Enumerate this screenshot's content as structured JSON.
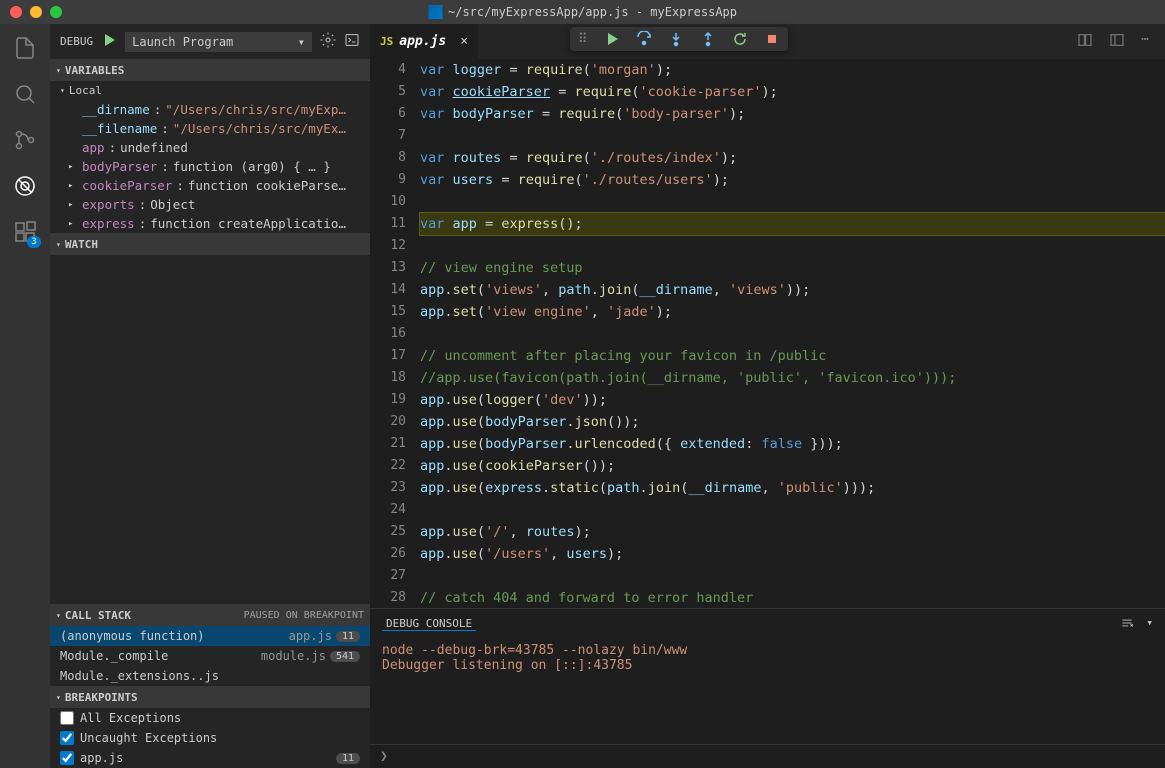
{
  "window": {
    "title": "~/src/myExpressApp/app.js - myExpressApp"
  },
  "activity": {
    "badge": "3"
  },
  "debug": {
    "label": "DEBUG",
    "config": "Launch Program",
    "configChevron": "▾"
  },
  "variables": {
    "header": "VARIABLES",
    "scope": "Local",
    "items": [
      {
        "arrow": "",
        "name": "__dirname",
        "nameClass": "vname-special",
        "sep": ":",
        "val": "\"/Users/chris/src/myExp…",
        "valClass": "vstr"
      },
      {
        "arrow": "",
        "name": "__filename",
        "nameClass": "vname-special",
        "sep": ":",
        "val": "\"/Users/chris/src/myEx…",
        "valClass": "vstr"
      },
      {
        "arrow": "",
        "name": "app",
        "nameClass": "vname",
        "sep": ":",
        "val": "undefined",
        "valClass": "vval"
      },
      {
        "arrow": "▸",
        "name": "bodyParser",
        "nameClass": "vname",
        "sep": ":",
        "val": "function (arg0) { … }",
        "valClass": "vval"
      },
      {
        "arrow": "▸",
        "name": "cookieParser",
        "nameClass": "vname",
        "sep": ":",
        "val": "function cookieParse…",
        "valClass": "vval"
      },
      {
        "arrow": "▸",
        "name": "exports",
        "nameClass": "vname",
        "sep": ":",
        "val": "Object",
        "valClass": "vval"
      },
      {
        "arrow": "▸",
        "name": "express",
        "nameClass": "vname",
        "sep": ":",
        "val": "function createApplicatio…",
        "valClass": "vval"
      }
    ]
  },
  "watch": {
    "header": "WATCH"
  },
  "callstack": {
    "header": "CALL STACK",
    "status": "PAUSED ON BREAKPOINT",
    "frames": [
      {
        "name": "(anonymous function)",
        "file": "app.js",
        "line": "11",
        "active": true
      },
      {
        "name": "Module._compile",
        "file": "module.js",
        "line": "541",
        "active": false
      },
      {
        "name": "Module._extensions..js",
        "file": "",
        "line": "",
        "active": false
      }
    ]
  },
  "breakpoints": {
    "header": "BREAKPOINTS",
    "items": [
      {
        "checked": false,
        "label": "All Exceptions",
        "badge": ""
      },
      {
        "checked": true,
        "label": "Uncaught Exceptions",
        "badge": ""
      },
      {
        "checked": true,
        "label": "app.js",
        "badge": "11"
      }
    ]
  },
  "tab": {
    "icon": "JS",
    "name": "app.js",
    "close": "×"
  },
  "editor": {
    "lines": [
      {
        "n": 4,
        "html": "<span class='kw'>var</span> <span class='id'>logger</span> <span class='pn'>=</span> <span class='fn'>require</span><span class='pn'>(</span><span class='str'>'morgan'</span><span class='pn'>);</span>"
      },
      {
        "n": 5,
        "html": "<span class='kw'>var</span> <span class='id linku'>cookieParser</span> <span class='pn'>=</span> <span class='fn'>require</span><span class='pn'>(</span><span class='str'>'cookie-parser'</span><span class='pn'>);</span>"
      },
      {
        "n": 6,
        "html": "<span class='kw'>var</span> <span class='id'>bodyParser</span> <span class='pn'>=</span> <span class='fn'>require</span><span class='pn'>(</span><span class='str'>'body-parser'</span><span class='pn'>);</span>"
      },
      {
        "n": 7,
        "html": ""
      },
      {
        "n": 8,
        "html": "<span class='kw'>var</span> <span class='id'>routes</span> <span class='pn'>=</span> <span class='fn'>require</span><span class='pn'>(</span><span class='str'>'./routes/index'</span><span class='pn'>);</span>"
      },
      {
        "n": 9,
        "html": "<span class='kw'>var</span> <span class='id'>users</span> <span class='pn'>=</span> <span class='fn'>require</span><span class='pn'>(</span><span class='str'>'./routes/users'</span><span class='pn'>);</span>"
      },
      {
        "n": 10,
        "html": ""
      },
      {
        "n": 11,
        "hl": true,
        "bp": true,
        "html": "<span class='kw'>var</span> <span class='id'>app</span> <span class='pn'>=</span> <span class='fn'>express</span><span class='pn'>();</span>"
      },
      {
        "n": 12,
        "html": ""
      },
      {
        "n": 13,
        "html": "<span class='cm'>// view engine setup</span>"
      },
      {
        "n": 14,
        "html": "<span class='id'>app</span><span class='pn'>.</span><span class='fn'>set</span><span class='pn'>(</span><span class='str'>'views'</span><span class='pn'>, </span><span class='id'>path</span><span class='pn'>.</span><span class='fn'>join</span><span class='pn'>(</span><span class='id'>__dirname</span><span class='pn'>, </span><span class='str'>'views'</span><span class='pn'>));</span>"
      },
      {
        "n": 15,
        "html": "<span class='id'>app</span><span class='pn'>.</span><span class='fn'>set</span><span class='pn'>(</span><span class='str'>'view engine'</span><span class='pn'>, </span><span class='str'>'jade'</span><span class='pn'>);</span>"
      },
      {
        "n": 16,
        "html": ""
      },
      {
        "n": 17,
        "html": "<span class='cm'>// uncomment after placing your favicon in /public</span>"
      },
      {
        "n": 18,
        "html": "<span class='cm'>//app.use(favicon(path.join(__dirname, 'public', 'favicon.ico')));</span>"
      },
      {
        "n": 19,
        "html": "<span class='id'>app</span><span class='pn'>.</span><span class='fn'>use</span><span class='pn'>(</span><span class='fn'>logger</span><span class='pn'>(</span><span class='str'>'dev'</span><span class='pn'>));</span>"
      },
      {
        "n": 20,
        "html": "<span class='id'>app</span><span class='pn'>.</span><span class='fn'>use</span><span class='pn'>(</span><span class='id'>bodyParser</span><span class='pn'>.</span><span class='fn'>json</span><span class='pn'>());</span>"
      },
      {
        "n": 21,
        "html": "<span class='id'>app</span><span class='pn'>.</span><span class='fn'>use</span><span class='pn'>(</span><span class='id'>bodyParser</span><span class='pn'>.</span><span class='fn'>urlencoded</span><span class='pn'>({ </span><span class='id'>extended</span><span class='pn'>: </span><span class='kw'>false</span><span class='pn'> }));</span>"
      },
      {
        "n": 22,
        "html": "<span class='id'>app</span><span class='pn'>.</span><span class='fn'>use</span><span class='pn'>(</span><span class='fn'>cookieParser</span><span class='pn'>());</span>"
      },
      {
        "n": 23,
        "html": "<span class='id'>app</span><span class='pn'>.</span><span class='fn'>use</span><span class='pn'>(</span><span class='id'>express</span><span class='pn'>.</span><span class='fn'>static</span><span class='pn'>(</span><span class='id'>path</span><span class='pn'>.</span><span class='fn'>join</span><span class='pn'>(</span><span class='id'>__dirname</span><span class='pn'>, </span><span class='str'>'public'</span><span class='pn'>)));</span>"
      },
      {
        "n": 24,
        "html": ""
      },
      {
        "n": 25,
        "html": "<span class='id'>app</span><span class='pn'>.</span><span class='fn'>use</span><span class='pn'>(</span><span class='str'>'/'</span><span class='pn'>, </span><span class='id'>routes</span><span class='pn'>);</span>"
      },
      {
        "n": 26,
        "html": "<span class='id'>app</span><span class='pn'>.</span><span class='fn'>use</span><span class='pn'>(</span><span class='str'>'/users'</span><span class='pn'>, </span><span class='id'>users</span><span class='pn'>);</span>"
      },
      {
        "n": 27,
        "html": ""
      },
      {
        "n": 28,
        "html": "<span class='cm'>// catch 404 and forward to error handler</span>"
      }
    ]
  },
  "panel": {
    "tab": "DEBUG CONSOLE",
    "lines": [
      "node --debug-brk=43785 --nolazy bin/www",
      "Debugger listening on [::]:43785"
    ],
    "prompt": "❯"
  }
}
